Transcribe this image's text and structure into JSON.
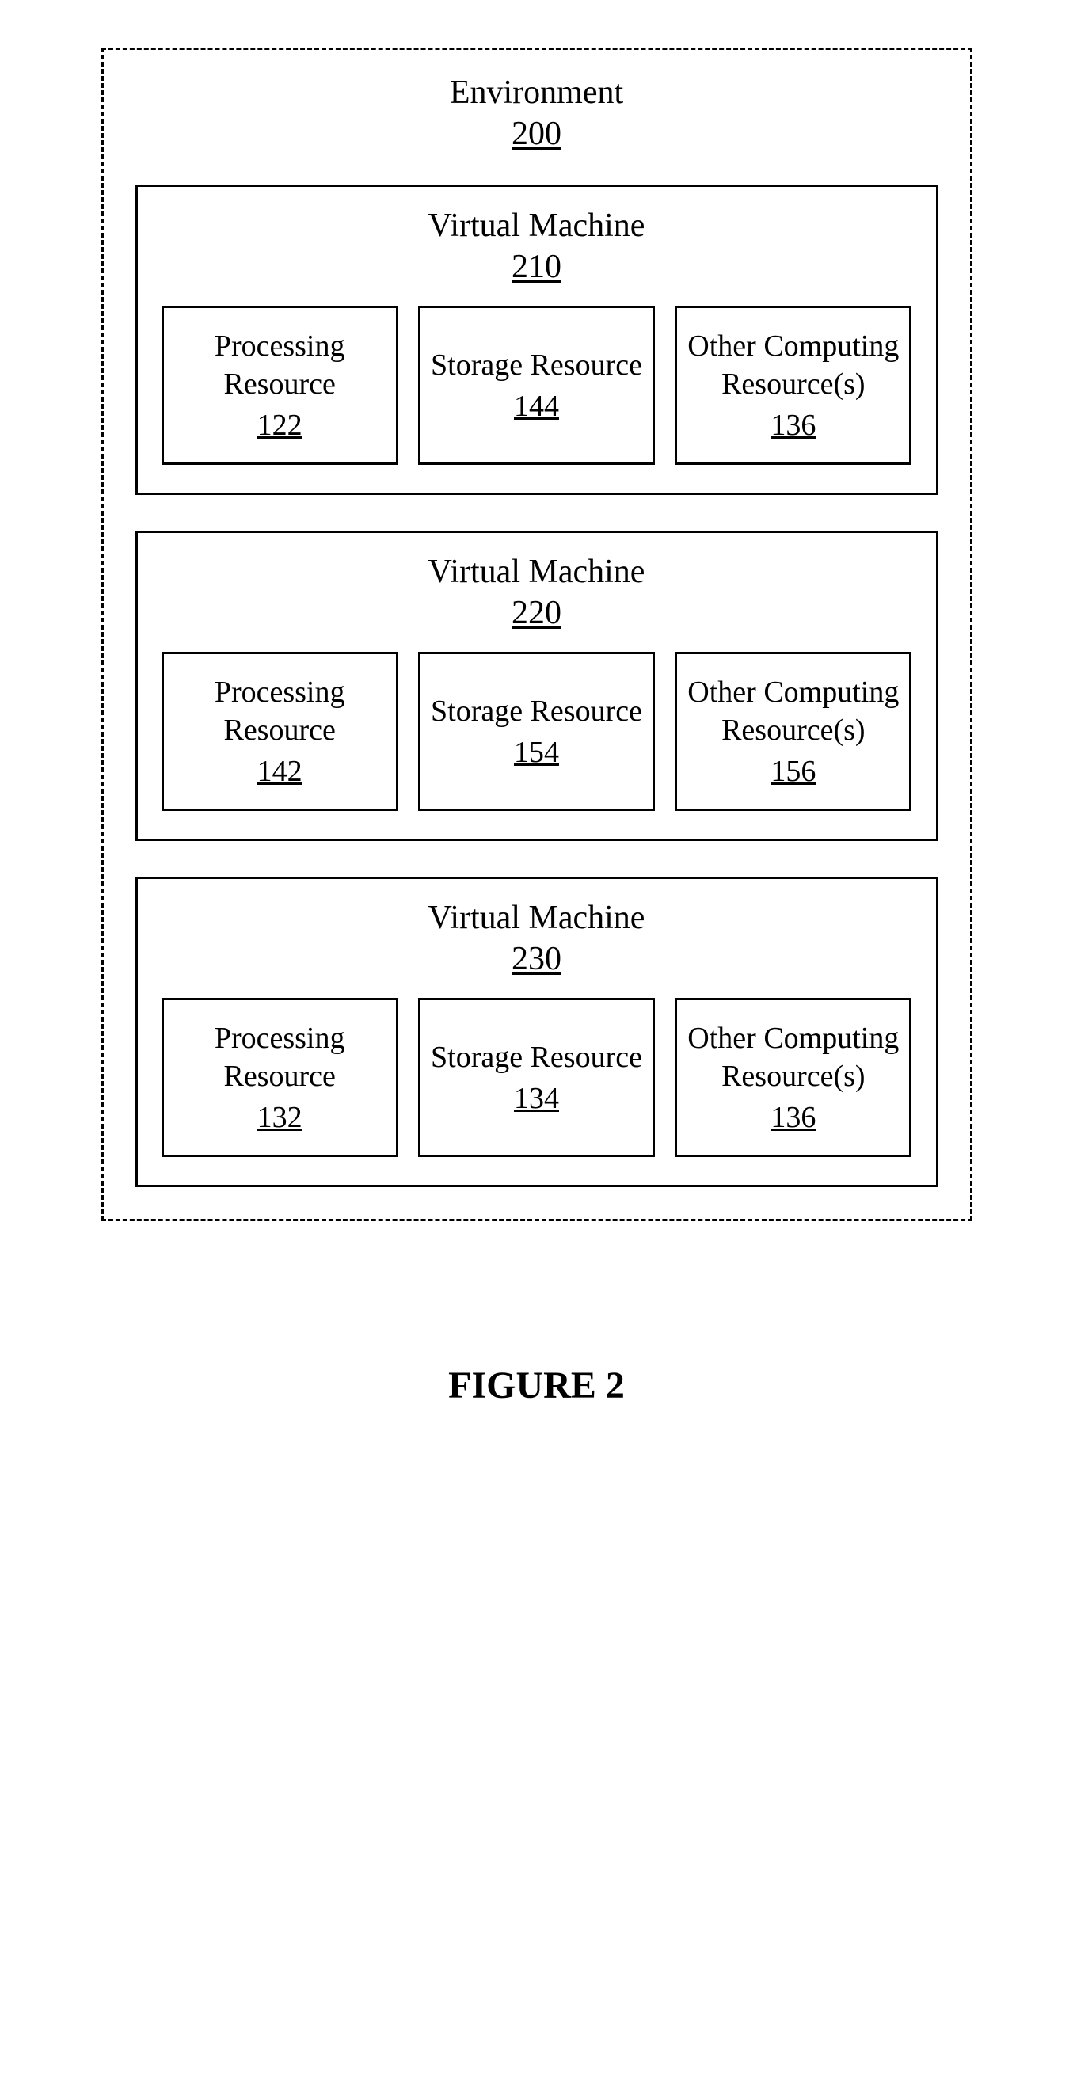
{
  "environment": {
    "title": "Environment",
    "number": "200"
  },
  "vms": [
    {
      "title": "Virtual Machine",
      "number": "210",
      "resources": [
        {
          "label": "Processing Resource",
          "number": "122"
        },
        {
          "label": "Storage Resource",
          "number": "144"
        },
        {
          "label": "Other Computing Resource(s)",
          "number": "136"
        }
      ]
    },
    {
      "title": "Virtual Machine",
      "number": "220",
      "resources": [
        {
          "label": "Processing Resource",
          "number": "142"
        },
        {
          "label": "Storage Resource",
          "number": "154"
        },
        {
          "label": "Other Computing Resource(s)",
          "number": "156"
        }
      ]
    },
    {
      "title": "Virtual Machine",
      "number": "230",
      "resources": [
        {
          "label": "Processing Resource",
          "number": "132"
        },
        {
          "label": "Storage Resource",
          "number": "134"
        },
        {
          "label": "Other Computing Resource(s)",
          "number": "136"
        }
      ]
    }
  ],
  "figure_label": "FIGURE 2"
}
